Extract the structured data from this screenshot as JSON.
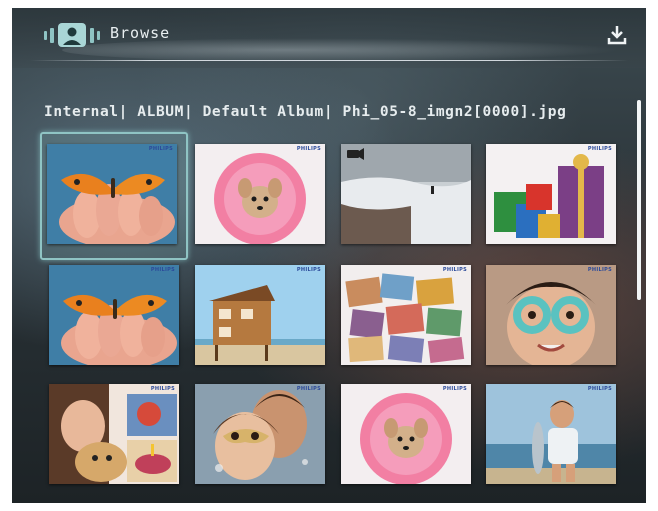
{
  "header": {
    "title": "Browse",
    "mode_icon": "person-photo-icon",
    "action_icon": "download-icon"
  },
  "breadcrumb": {
    "text": "Internal| ALBUM| Default Album| Phi_05-8_imgn2[0000].jpg"
  },
  "thumbnails": [
    {
      "subject": "butterfly-on-hand",
      "brand": "PHILIPS",
      "selected": true
    },
    {
      "subject": "dog-in-pink-flower",
      "brand": "PHILIPS",
      "selected": false
    },
    {
      "subject": "snow-video",
      "brand": "",
      "selected": false,
      "video": true
    },
    {
      "subject": "gift-boxes",
      "brand": "PHILIPS",
      "selected": false
    },
    {
      "subject": "butterfly-on-hand",
      "brand": "PHILIPS",
      "selected": false
    },
    {
      "subject": "beach-house",
      "brand": "PHILIPS",
      "selected": false
    },
    {
      "subject": "photo-collage",
      "brand": "PHILIPS",
      "selected": false
    },
    {
      "subject": "girl-with-hand-glasses",
      "brand": "PHILIPS",
      "selected": false
    },
    {
      "subject": "girl-with-puppy",
      "brand": "PHILIPS",
      "selected": false
    },
    {
      "subject": "couple-masquerade",
      "brand": "PHILIPS",
      "selected": false
    },
    {
      "subject": "dog-in-pink-flower",
      "brand": "PHILIPS",
      "selected": false
    },
    {
      "subject": "boy-with-fish",
      "brand": "PHILIPS",
      "selected": false
    }
  ],
  "scrollbar": {
    "position": 0.0
  },
  "colors": {
    "accent": "#8fc4c4",
    "text": "#e6ecee"
  }
}
